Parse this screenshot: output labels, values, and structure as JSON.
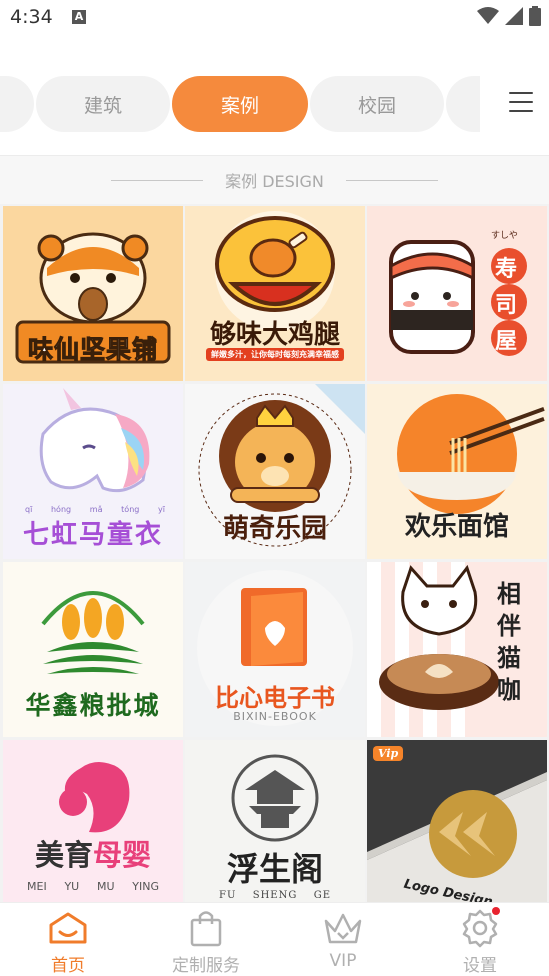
{
  "status_bar": {
    "time": "4:34",
    "notification_badge": "A"
  },
  "tabs": [
    {
      "label": "",
      "active": false
    },
    {
      "label": "建筑",
      "active": false
    },
    {
      "label": "案例",
      "active": true
    },
    {
      "label": "校园",
      "active": false
    },
    {
      "label": "",
      "active": false
    }
  ],
  "section": {
    "title": "案例 DESIGN"
  },
  "cases": [
    {
      "name": "味仙坚果铺"
    },
    {
      "name": "够味大鸡腿",
      "subtitle": "鲜嫩多汁，让你每时每刻充满幸福感"
    },
    {
      "name": "寿司屋",
      "kana": "すしや",
      "chars": [
        "寿",
        "司",
        "屋"
      ]
    },
    {
      "name": "七虹马童衣",
      "pinyin": [
        "qī",
        "hóng",
        "mǎ",
        "tóng",
        "yī"
      ]
    },
    {
      "name": "萌奇乐园"
    },
    {
      "name": "欢乐面馆"
    },
    {
      "name": "华鑫粮批城"
    },
    {
      "name": "比心电子书",
      "subtitle": "BIXIN-EBOOK"
    },
    {
      "name": "相伴猫咖",
      "chars": [
        "相",
        "伴",
        "猫",
        "咖"
      ]
    },
    {
      "name_a": "美育",
      "name_b": "母婴",
      "pinyin": [
        "MEI",
        "YU",
        "MU",
        "YING"
      ]
    },
    {
      "name": "浮生阁",
      "pinyin": [
        "FU",
        "SHENG",
        "GE"
      ]
    },
    {
      "name": "Logo Design",
      "badge": "Vip"
    }
  ],
  "bottom_nav": [
    {
      "label": "首页",
      "icon": "home-icon",
      "active": true
    },
    {
      "label": "定制服务",
      "icon": "shopping-bag-icon",
      "active": false
    },
    {
      "label": "VIP",
      "icon": "crown-icon",
      "active": false
    },
    {
      "label": "设置",
      "icon": "gear-icon",
      "active": false
    }
  ],
  "colors": {
    "accent": "#f58a3d",
    "active_nav": "#f07c2b",
    "inactive": "#b0b0b0"
  }
}
